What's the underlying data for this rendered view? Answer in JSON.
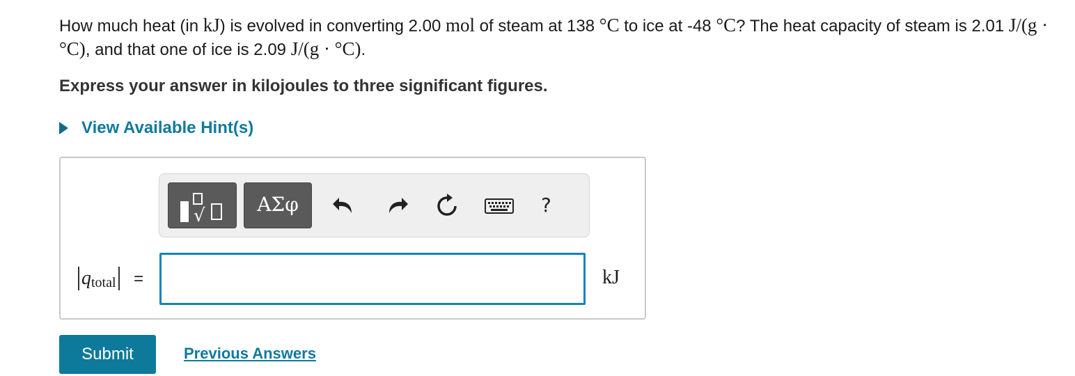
{
  "question": {
    "t1": "How much heat (in ",
    "m1": "kJ",
    "t2": ") is evolved in converting 2.00 ",
    "m2": "mol",
    "t3": " of steam at 138 ",
    "m3": "°C",
    "t4": " to ice at -48 ",
    "m4": "°C",
    "t5": "? The heat capacity of steam is 2.01 ",
    "m5": "J/(g · °C)",
    "t6": ", and that one of ice is 2.09 ",
    "m6": "J/(g · °C)",
    "t7": "."
  },
  "instruction": "Express your answer in kilojoules to three significant figures.",
  "hint_label": "View Available Hint(s)",
  "toolbar": {
    "greek_label": "ΑΣφ",
    "help_label": "?",
    "icons": [
      "templates-icon",
      "undo-icon",
      "redo-icon",
      "reset-icon",
      "keyboard-icon",
      "help-icon"
    ]
  },
  "answer": {
    "label_var": "q",
    "label_sub": "total",
    "equals": "=",
    "value": "",
    "unit": "kJ"
  },
  "submit_label": "Submit",
  "previous_answers_label": "Previous Answers",
  "colors": {
    "accent": "#0e7a9b",
    "input_border": "#1484b8",
    "link": "#0f7a9e",
    "toolbar_button": "#5a5a5a"
  }
}
